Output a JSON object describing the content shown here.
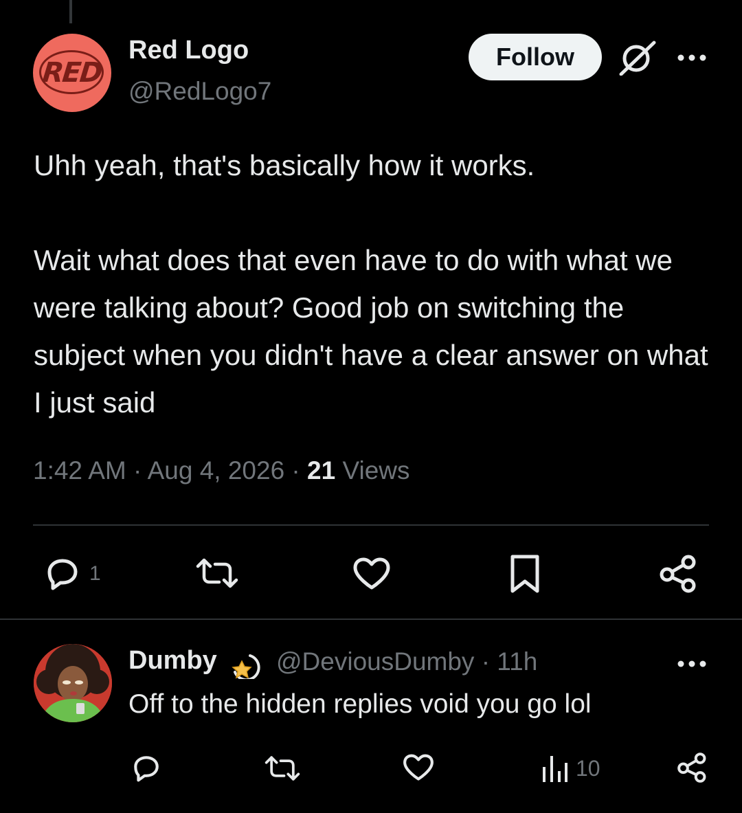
{
  "tweet": {
    "author_name": "Red Logo",
    "author_handle": "@RedLogo7",
    "avatar_text": "RED",
    "follow_label": "Follow",
    "paragraph1": "Uhh yeah, that's basically how it works.",
    "paragraph2": "Wait what does that even have to do with what we were talking about? Good job on switching the subject when you didn't have a clear answer on what I just said",
    "timestamp": "1:42 AM · Aug 4, 2026 · ",
    "views_count": "21",
    "views_label": "Views",
    "reply_count": "1"
  },
  "reply": {
    "author_name": "Dumby",
    "author_handle": "@DeviousDumby · 11h",
    "text": "Off to the hidden replies void you go lol",
    "views_count": "10"
  },
  "colors": {
    "background": "#000000",
    "text": "#e7e9ea",
    "muted": "#71767b",
    "divider": "#2f3336",
    "follow_bg": "#eff3f4",
    "avatar_red": "#ef6a5e"
  },
  "icons": [
    "grok-icon",
    "more-icon",
    "reply-icon",
    "retweet-icon",
    "like-icon",
    "bookmark-icon",
    "share-icon",
    "views-icon",
    "shooting-star-icon"
  ]
}
